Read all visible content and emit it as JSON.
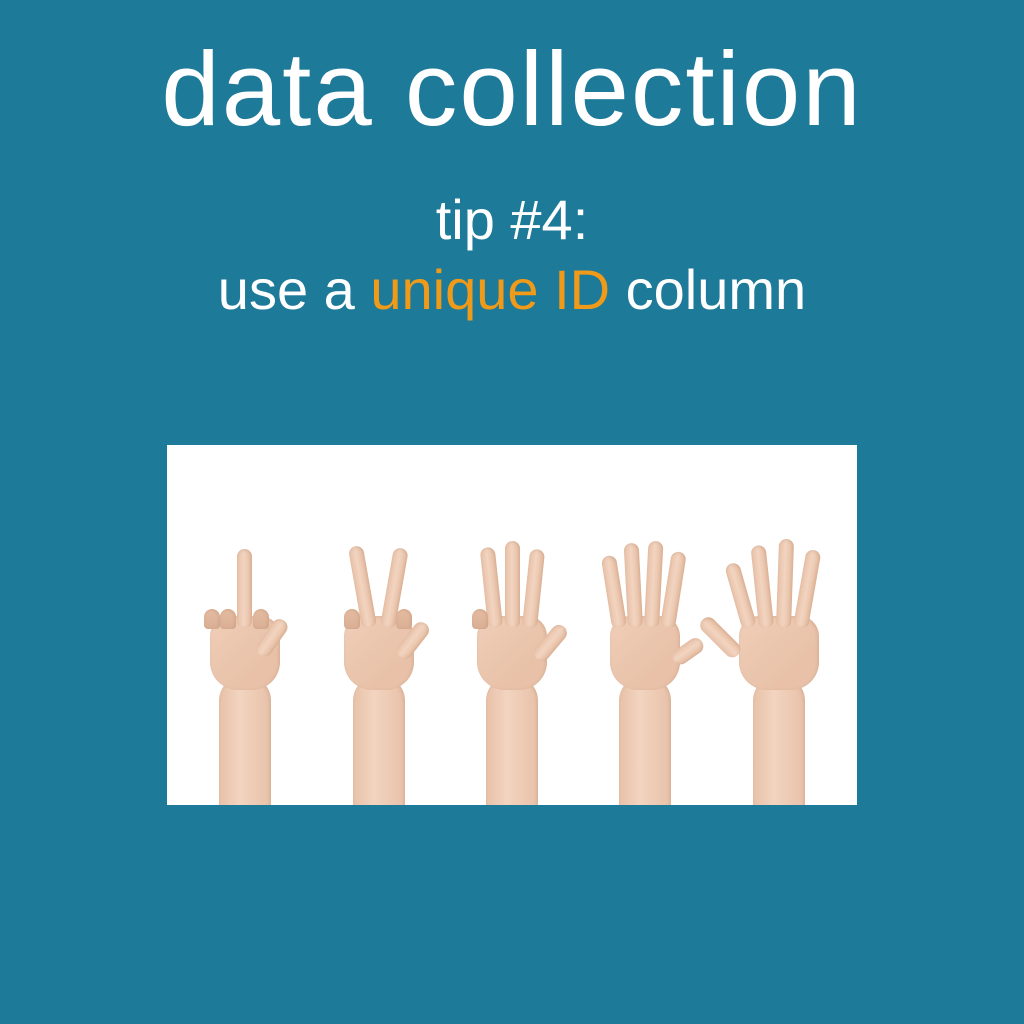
{
  "title": "data collection",
  "subtitle": {
    "line1": "tip #4:",
    "line2_pre": "use a ",
    "line2_accent": "unique ID",
    "line2_post": " column"
  },
  "colors": {
    "background": "#1d7a99",
    "text": "#ffffff",
    "accent": "#f09a1a"
  },
  "image": {
    "description": "five hands counting one through five fingers",
    "hands": [
      1,
      2,
      3,
      4,
      5
    ]
  }
}
